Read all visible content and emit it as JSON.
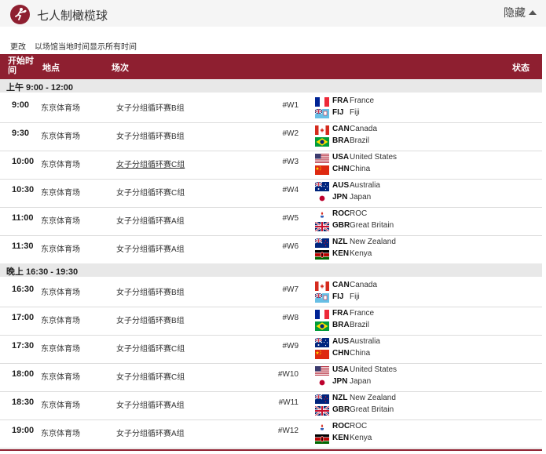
{
  "header": {
    "sport_title": "七人制橄榄球",
    "hide_label": "隐藏"
  },
  "timezone": {
    "change_label": "更改",
    "note": "以场馆当地时间显示所有时间"
  },
  "table_header": {
    "time": "开始时间",
    "venue": "地点",
    "event": "场次",
    "status": "状态"
  },
  "sections": [
    {
      "label": "上午  9:00 - 12:00",
      "rows": [
        {
          "time": "9:00",
          "venue": "东京体育场",
          "event": "女子分组循环赛B组",
          "code": "#W1",
          "team1": {
            "code": "FRA",
            "name": "France",
            "flag": "fra"
          },
          "team2": {
            "code": "FIJ",
            "name": "Fiji",
            "flag": "fij"
          }
        },
        {
          "time": "9:30",
          "venue": "东京体育场",
          "event": "女子分组循环赛B组",
          "code": "#W2",
          "team1": {
            "code": "CAN",
            "name": "Canada",
            "flag": "can"
          },
          "team2": {
            "code": "BRA",
            "name": "Brazil",
            "flag": "bra"
          }
        },
        {
          "time": "10:00",
          "venue": "东京体育场",
          "event": "女子分组循环赛C组",
          "code": "#W3",
          "link": true,
          "team1": {
            "code": "USA",
            "name": "United States",
            "flag": "usa"
          },
          "team2": {
            "code": "CHN",
            "name": "China",
            "flag": "chn"
          }
        },
        {
          "time": "10:30",
          "venue": "东京体育场",
          "event": "女子分组循环赛C组",
          "code": "#W4",
          "team1": {
            "code": "AUS",
            "name": "Australia",
            "flag": "aus"
          },
          "team2": {
            "code": "JPN",
            "name": "Japan",
            "flag": "jpn"
          }
        },
        {
          "time": "11:00",
          "venue": "东京体育场",
          "event": "女子分组循环赛A组",
          "code": "#W5",
          "team1": {
            "code": "ROC",
            "name": "ROC",
            "flag": "roc"
          },
          "team2": {
            "code": "GBR",
            "name": "Great Britain",
            "flag": "gbr"
          }
        },
        {
          "time": "11:30",
          "venue": "东京体育场",
          "event": "女子分组循环赛A组",
          "code": "#W6",
          "team1": {
            "code": "NZL",
            "name": "New Zealand",
            "flag": "nzl"
          },
          "team2": {
            "code": "KEN",
            "name": "Kenya",
            "flag": "ken"
          }
        }
      ]
    },
    {
      "label": "晚上  16:30 - 19:30",
      "rows": [
        {
          "time": "16:30",
          "venue": "东京体育场",
          "event": "女子分组循环赛B组",
          "code": "#W7",
          "team1": {
            "code": "CAN",
            "name": "Canada",
            "flag": "can"
          },
          "team2": {
            "code": "FIJ",
            "name": "Fiji",
            "flag": "fij"
          }
        },
        {
          "time": "17:00",
          "venue": "东京体育场",
          "event": "女子分组循环赛B组",
          "code": "#W8",
          "team1": {
            "code": "FRA",
            "name": "France",
            "flag": "fra"
          },
          "team2": {
            "code": "BRA",
            "name": "Brazil",
            "flag": "bra"
          }
        },
        {
          "time": "17:30",
          "venue": "东京体育场",
          "event": "女子分组循环赛C组",
          "code": "#W9",
          "team1": {
            "code": "AUS",
            "name": "Australia",
            "flag": "aus"
          },
          "team2": {
            "code": "CHN",
            "name": "China",
            "flag": "chn"
          }
        },
        {
          "time": "18:00",
          "venue": "东京体育场",
          "event": "女子分组循环赛C组",
          "code": "#W10",
          "team1": {
            "code": "USA",
            "name": "United States",
            "flag": "usa"
          },
          "team2": {
            "code": "JPN",
            "name": "Japan",
            "flag": "jpn"
          }
        },
        {
          "time": "18:30",
          "venue": "东京体育场",
          "event": "女子分组循环赛A组",
          "code": "#W11",
          "team1": {
            "code": "NZL",
            "name": "New Zealand",
            "flag": "nzl"
          },
          "team2": {
            "code": "GBR",
            "name": "Great Britain",
            "flag": "gbr"
          }
        },
        {
          "time": "19:00",
          "venue": "东京体育场",
          "event": "女子分组循环赛A组",
          "code": "#W12",
          "team1": {
            "code": "ROC",
            "name": "ROC",
            "flag": "roc"
          },
          "team2": {
            "code": "KEN",
            "name": "Kenya",
            "flag": "ken"
          }
        }
      ]
    }
  ],
  "colors": {
    "header_bg": "#8e1f30",
    "section_bg": "#e8e8e8",
    "topbar_bg": "#f5f5f5"
  },
  "icons": {
    "sport": "rugby-player-icon",
    "hide": "caret-up-icon"
  }
}
